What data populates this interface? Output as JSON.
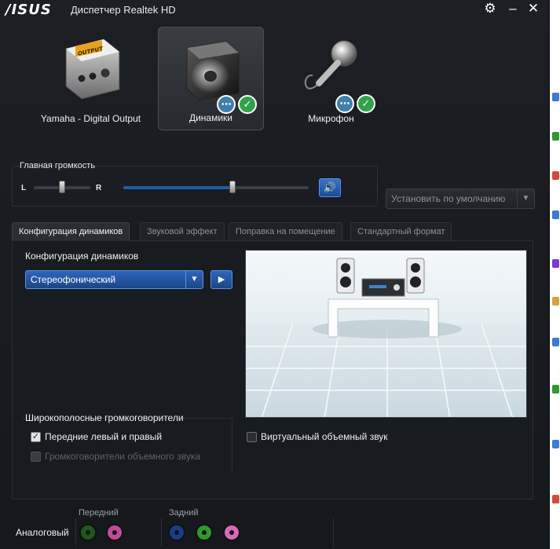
{
  "window": {
    "brand": "/ISUS",
    "title": "Диспетчер Realtek HD",
    "settings_icon": "gear-icon",
    "minimize_icon": "minimize-icon",
    "close_icon": "close-icon"
  },
  "devices": [
    {
      "label": "Yamaha - Digital Output",
      "icon": "digital-output-icon",
      "active": false,
      "display_text": "OUTPUT"
    },
    {
      "label": "Динамики",
      "icon": "speaker-icon",
      "active": true,
      "status": [
        "chat-icon",
        "check-icon"
      ]
    },
    {
      "label": "Микрофон",
      "icon": "microphone-icon",
      "active": false,
      "status": [
        "chat-icon",
        "check-icon"
      ]
    }
  ],
  "volume": {
    "title": "Главная громкость",
    "left_label": "L",
    "right_label": "R",
    "balance": 0.5,
    "level": 0.59,
    "mute_icon": "speaker-volume-icon"
  },
  "set_default": {
    "label": "Установить по умолчанию",
    "dropdown_icon": "chevron-down-icon"
  },
  "tabs": [
    {
      "label": "Конфигурация динамиков",
      "active": true
    },
    {
      "label": "Звуковой эффект",
      "active": false
    },
    {
      "label": "Поправка на помещение",
      "active": false
    },
    {
      "label": "Стандартный формат",
      "active": false
    }
  ],
  "config": {
    "title": "Конфигурация динамиков",
    "selected": "Стереофонический",
    "play_icon": "play-icon"
  },
  "wideband": {
    "title": "Широкополосные громкоговорители",
    "options": [
      {
        "label": "Передние левый и правый",
        "checked": true,
        "enabled": true
      },
      {
        "label": "Громкоговорители объемного звука",
        "checked": false,
        "enabled": false
      }
    ]
  },
  "virtual_surround": {
    "label": "Виртуальный объемный звук",
    "checked": false
  },
  "jacks": {
    "analog_label": "Аналоговый",
    "front_label": "Передний",
    "rear_label": "Задний",
    "front": [
      {
        "color": "#1a5a1a"
      },
      {
        "color": "#c04a9a"
      }
    ],
    "rear": [
      {
        "color": "#1a3d8a"
      },
      {
        "color": "#2e9a2e"
      },
      {
        "color": "#d66ab8"
      }
    ]
  }
}
